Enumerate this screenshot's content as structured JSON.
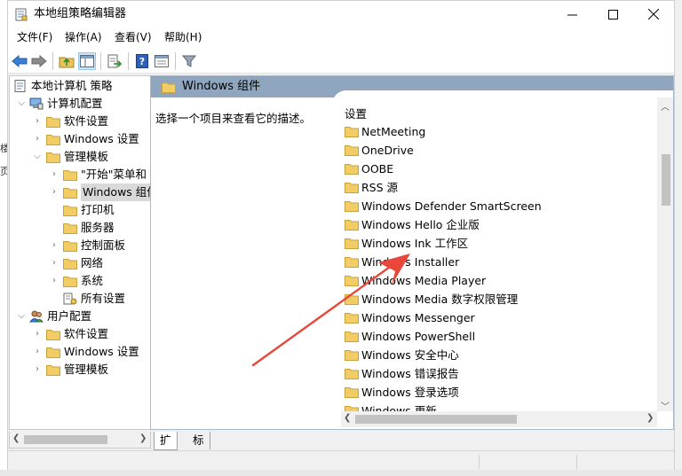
{
  "window": {
    "title": "本地组策略编辑器",
    "controls": {
      "minimize": "—",
      "maximize": "☐",
      "close": "✕"
    }
  },
  "menu": [
    {
      "label": "文件(F)"
    },
    {
      "label": "操作(A)"
    },
    {
      "label": "查看(V)"
    },
    {
      "label": "帮助(H)"
    }
  ],
  "left_fragments": [
    "楼",
    "页"
  ],
  "tree": {
    "root": "本地计算机 策略",
    "computer_config": "计算机配置",
    "cc_software": "软件设置",
    "cc_windows": "Windows 设置",
    "cc_admin": "管理模板",
    "at_start": "\"开始\"菜单和",
    "at_windows": "Windows 组件",
    "at_printers": "打印机",
    "at_server": "服务器",
    "at_control": "控制面板",
    "at_network": "网络",
    "at_system": "系统",
    "at_all": "所有设置",
    "user_config": "用户配置",
    "uc_software": "软件设置",
    "uc_windows": "Windows 设置",
    "uc_admin": "管理模板"
  },
  "right": {
    "header": "Windows 组件",
    "description": "选择一个项目来查看它的描述。",
    "column_header": "设置",
    "items": [
      "NetMeeting",
      "OneDrive",
      "OOBE",
      "RSS 源",
      "Windows Defender SmartScreen",
      "Windows Hello 企业版",
      "Windows Ink 工作区",
      "Windows Installer",
      "Windows Media Player",
      "Windows Media 数字权限管理",
      "Windows Messenger",
      "Windows PowerShell",
      "Windows 安全中心",
      "Windows 错误报告",
      "Windows 登录选项",
      "Windows 更新"
    ]
  },
  "tabs": [
    {
      "label": "扩展"
    },
    {
      "label": "标准"
    }
  ],
  "colors": {
    "header_bg": "#8fa6be",
    "folder": "#e8c25b",
    "arrow": "#e8473a",
    "selection": "#d9d9d9"
  },
  "icons": {
    "back": "arrow-left-icon",
    "forward": "arrow-right-icon",
    "up": "folder-up-icon",
    "show_hide": "show-hide-tree-icon",
    "export": "export-list-icon",
    "help": "help-icon",
    "properties": "properties-icon",
    "filter": "filter-icon"
  }
}
